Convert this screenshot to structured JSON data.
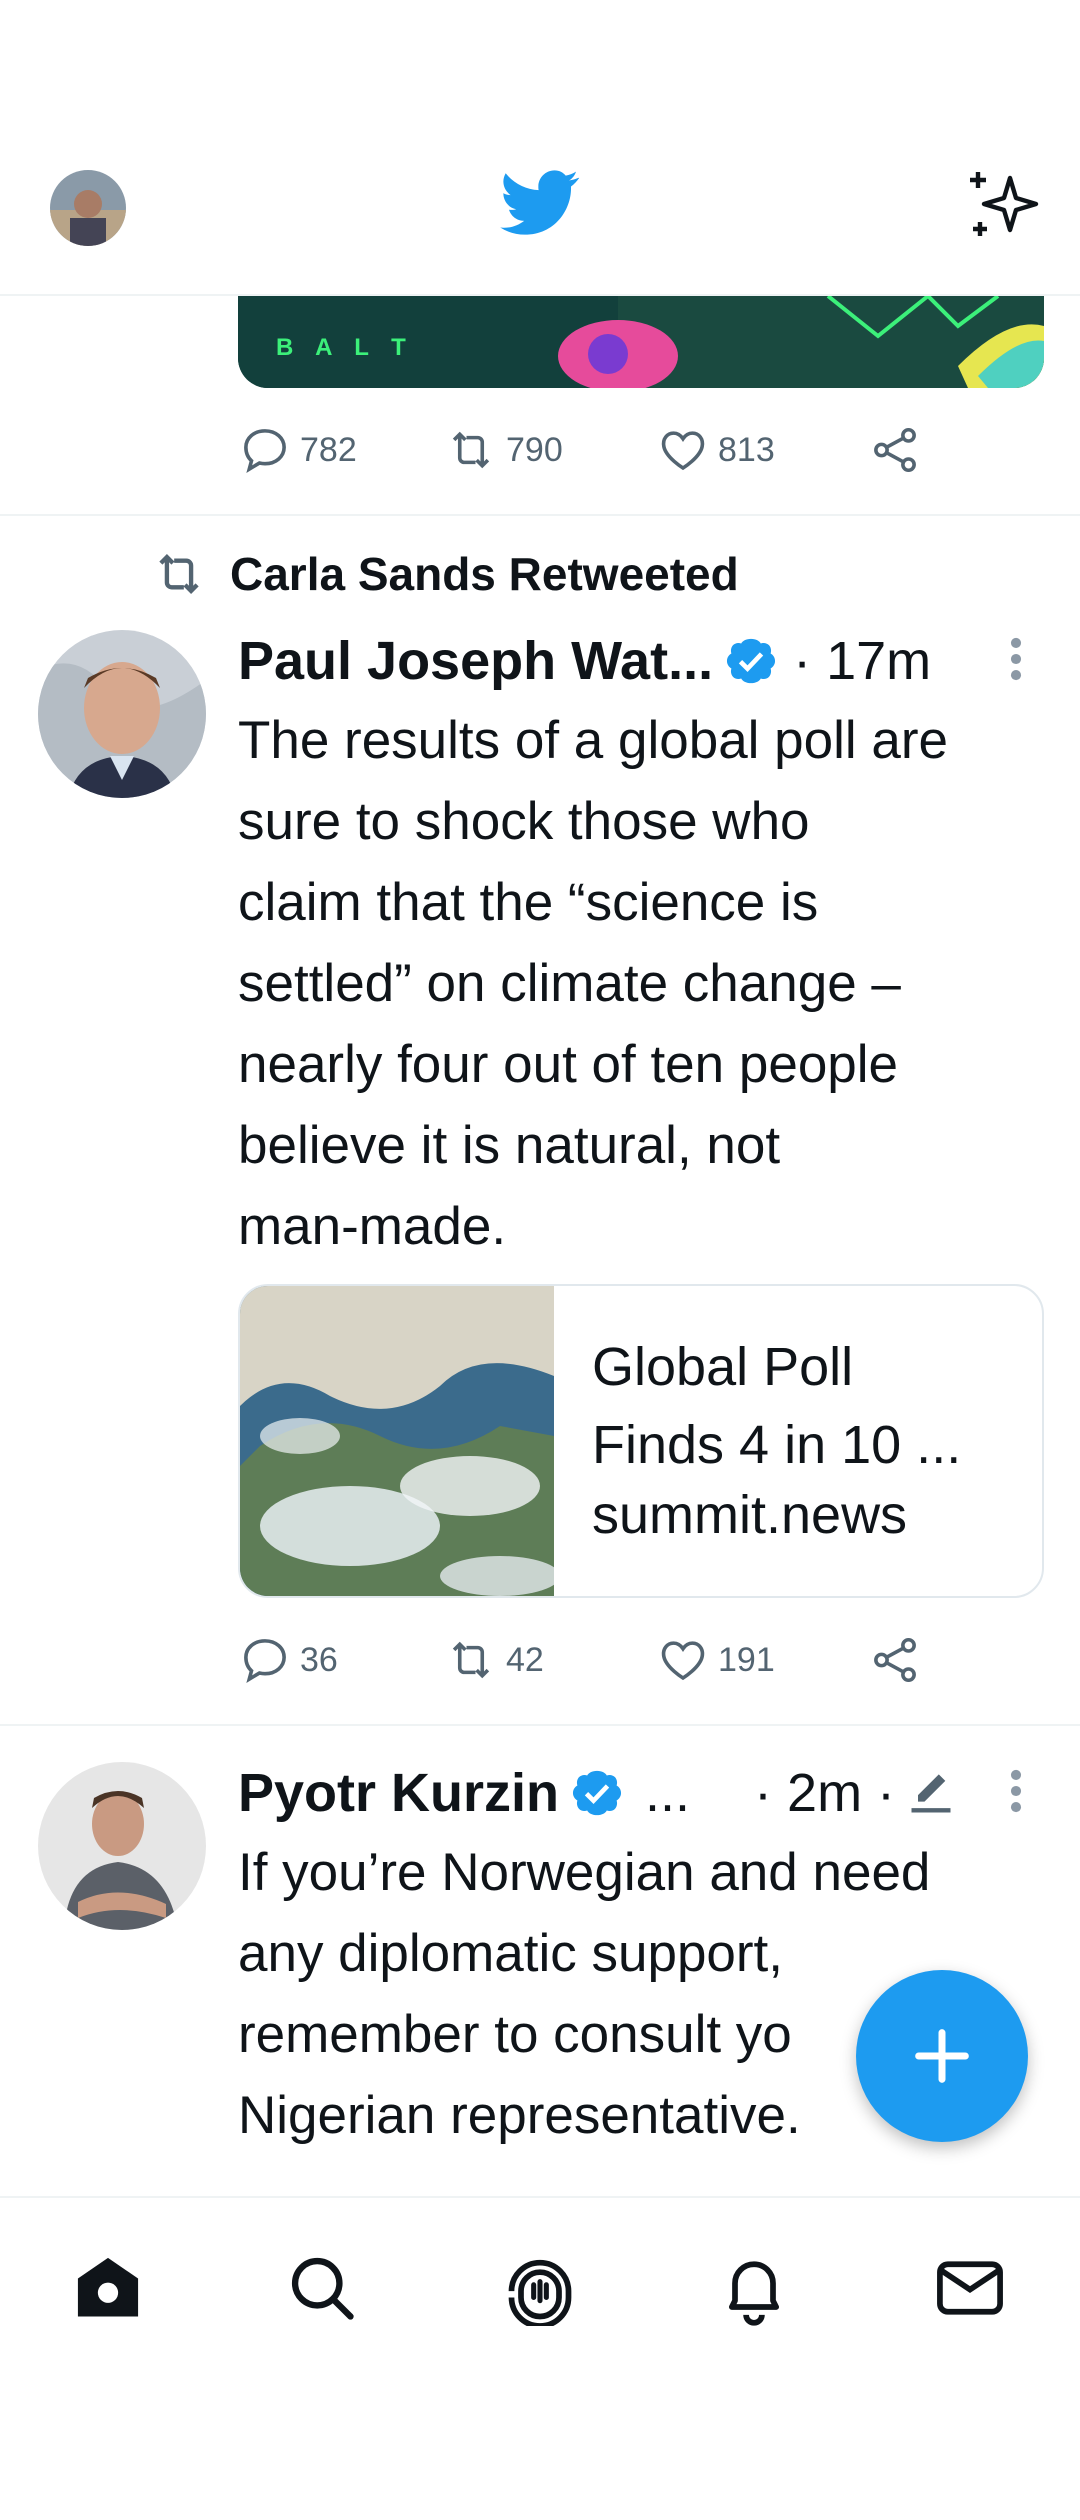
{
  "header": {
    "avatar_icon": "user-avatar",
    "logo_icon": "twitter-bird-icon",
    "sparkle_icon": "sparkle-icon",
    "brand_color": "#1d9bf0"
  },
  "tweet_prev": {
    "media_text": "B A L T",
    "replies": "782",
    "retweets": "790",
    "likes": "813"
  },
  "tweet1": {
    "retweeted_by": "Carla Sands Retweeted",
    "author": "Paul Joseph Wat...",
    "time": "· 17m",
    "text_lines": [
      "The results of a global poll are",
      "sure to shock those who",
      "claim that the “science is",
      "settled” on climate change –",
      "nearly four out of ten people",
      "believe it is natural, not",
      "man-made."
    ],
    "card": {
      "title_line1": "Global Poll",
      "title_line2": "Finds 4 in 10 ...",
      "domain": "summit.news"
    },
    "replies": "36",
    "retweets": "42",
    "likes": "191"
  },
  "tweet2": {
    "author": "Pyotr Kurzin",
    "ellipsis": "...",
    "time": "· 2m ·",
    "text_lines": [
      "If you’re Norwegian and need",
      "any diplomatic support,",
      "remember to consult yo",
      "Nigerian representative."
    ]
  },
  "tabbar": {
    "items": [
      "home-icon",
      "search-icon",
      "spaces-icon",
      "notifications-icon",
      "messages-icon"
    ]
  }
}
